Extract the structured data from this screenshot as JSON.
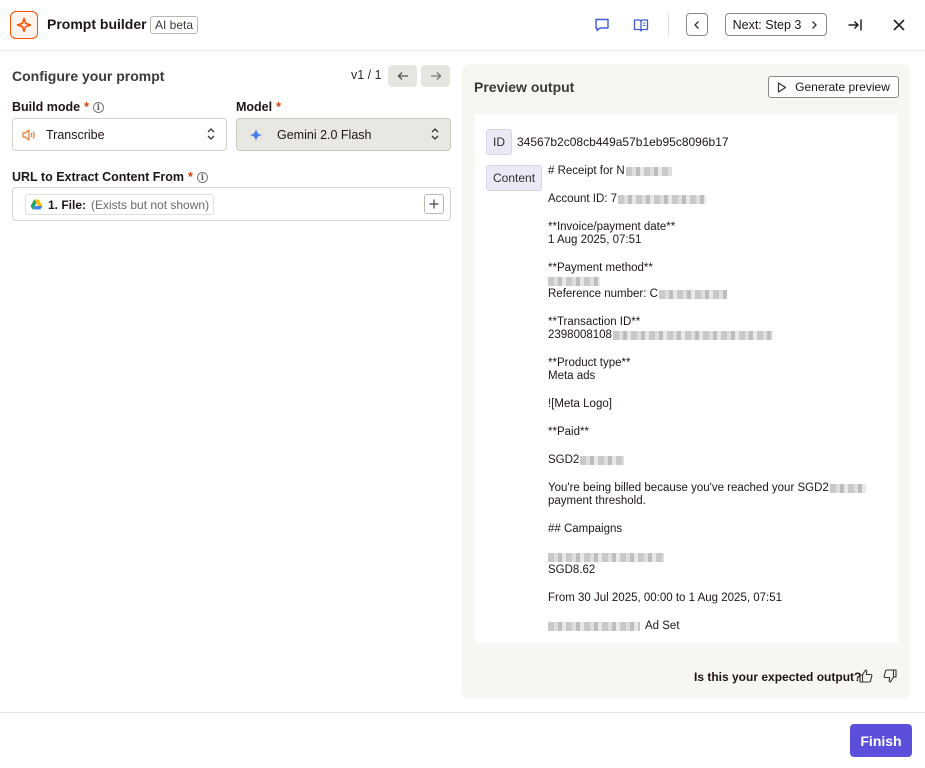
{
  "header": {
    "title": "Prompt builder",
    "badge": "AI beta",
    "next_label": "Next: Step 3",
    "icons": [
      "sparkle-logo-icon",
      "chat-icon",
      "book-icon",
      "chevron-left-icon",
      "chevron-right-icon",
      "collapse-panel-icon",
      "close-icon"
    ]
  },
  "config": {
    "title": "Configure your prompt",
    "version": "v1 / 1",
    "build_mode": {
      "label": "Build mode",
      "required": "*",
      "value": "Transcribe"
    },
    "model": {
      "label": "Model",
      "required": "*",
      "value": "Gemini 2.0 Flash"
    },
    "url": {
      "label": "URL to Extract Content From",
      "required": "*",
      "chip_name": "1. File:",
      "chip_note": "(Exists but not shown)"
    }
  },
  "preview": {
    "title": "Preview output",
    "generate_label": "Generate preview",
    "id_tag": "ID",
    "id_value": "34567b2c08cb449a57b1eb95c8096b17",
    "content_tag": "Content",
    "lines": [
      "# Receipt for N",
      "",
      "Account ID: 7",
      "",
      "**Invoice/payment date**",
      "1 Aug 2025, 07:51",
      "",
      "**Payment method**",
      "",
      "Reference number: C",
      "",
      "**Transaction ID**",
      "2398008108",
      "",
      "**Product type**",
      "Meta ads",
      "",
      "![Meta Logo]",
      "",
      "**Paid**",
      "",
      "SGD2",
      "",
      "You're being billed because you've reached your SGD2",
      "payment threshold.",
      "",
      "## Campaigns",
      "",
      "SGD8.62",
      "",
      "From 30 Jul 2025, 00:00 to 1 Aug 2025, 07:51",
      "",
      "Ad Set"
    ],
    "feedback_question": "Is this your expected output?"
  },
  "footer": {
    "finish_label": "Finish"
  },
  "colors": {
    "brand_orange": "#ff4f00",
    "primary_button": "#5b4fdb",
    "icon_blue": "#3b5bdb",
    "tag_bg": "#ece9f7"
  }
}
